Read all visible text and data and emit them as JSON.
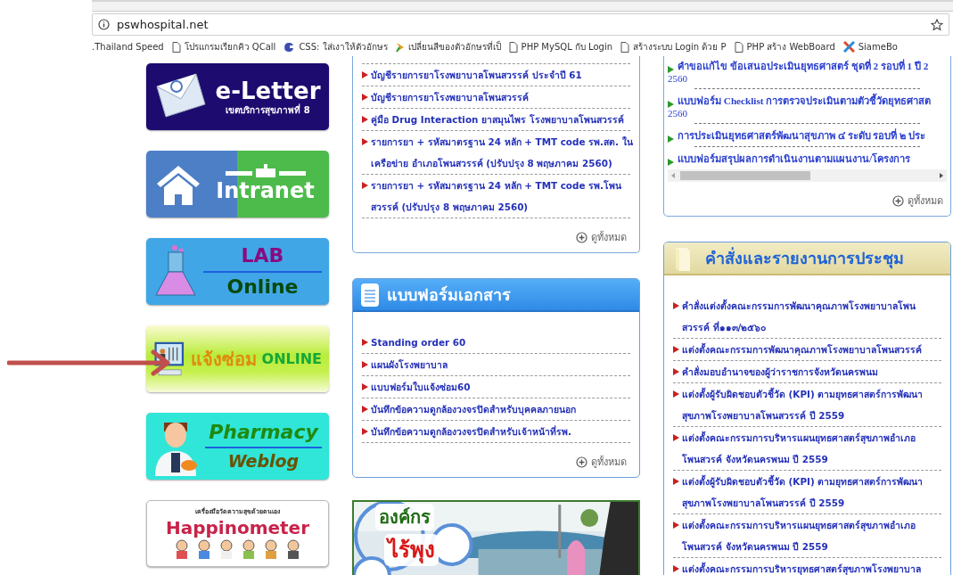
{
  "browser": {
    "url": "pswhospital.net",
    "bookmarks": [
      {
        "kind": "none",
        "label": ".Thailand Speed"
      },
      {
        "kind": "page",
        "label": "โปรแกรมเรียกคิว QCall"
      },
      {
        "kind": "circle",
        "label": "CSS: ใส่เงาให้ตัวอักษร"
      },
      {
        "kind": "arrow",
        "label": "เปลี่ยนสีของตัวอักษรที่เป็"
      },
      {
        "kind": "page",
        "label": "PHP MySQL กับ Login"
      },
      {
        "kind": "page",
        "label": "สร้างระบบ Login ด้วย P"
      },
      {
        "kind": "page",
        "label": "PHP สร้าง WebBoard"
      },
      {
        "kind": "cross",
        "label": "SiameBo"
      }
    ]
  },
  "banners": [
    {
      "kind": "eletter",
      "title": "e-Letter",
      "subtitle": "เขตบริการสุขภาพที่ 8"
    },
    {
      "kind": "intranet",
      "title": "Intranet"
    },
    {
      "kind": "lab",
      "title": "LAB",
      "subtitle": "Online"
    },
    {
      "kind": "repair",
      "title": "แจ้งซ่อม",
      "subtitle": "ONLINE"
    },
    {
      "kind": "pharmacy",
      "title": "Pharmacy",
      "subtitle": "Weblog"
    },
    {
      "kind": "happinometer",
      "title": "Happinometer",
      "subtitle": "เครื่องมือวัดความสุขด้วยตนเอง"
    }
  ],
  "drug_panel": {
    "items": [
      {
        "lines": [
          "บัญชีรายการยาโรงพยาบาลโพนสวรรค์ ประจำปี 61"
        ]
      },
      {
        "lines": [
          "บัญชีรายการยาโรงพยาบาลโพนสวรรค์"
        ]
      },
      {
        "lines": [
          "คู่มือ Drug Interaction ยาสมุนไพร โรงพยาบาลโพนสวรรค์"
        ]
      },
      {
        "lines": [
          "รายการยา + รหัสมาตรฐาน 24 หลัก + TMT code รพ.สต. ใน",
          "เครือข่าย อำเภอโพนสวรรค์ (ปรับปรุง 8 พฤษภาคม 2560)"
        ]
      },
      {
        "lines": [
          "รายการยา + รหัสมาตรฐาน 24 หลัก + TMT code รพ.โพน",
          "สวรรค์ (ปรับปรุง 8 พฤษภาคม 2560)"
        ]
      }
    ],
    "more": "ดูทั้งหมด"
  },
  "forms_panel": {
    "title": "แบบฟอร์มเอกสาร",
    "items": [
      {
        "lines": [
          "Standing order 60"
        ]
      },
      {
        "lines": [
          "แผนผังโรงพยาบาล"
        ]
      },
      {
        "lines": [
          "แบบฟอร์มใบแจ้งซ่อม60"
        ]
      },
      {
        "lines": [
          "บันทึกข้อความดูกล้องวงจรปิดสำหรับบุคคลภายนอก"
        ]
      },
      {
        "lines": [
          "บันทึกข้อความดูกล้องวงจรปิดสำหรับเจ้าหน้าที่รพ."
        ]
      }
    ],
    "more": "ดูทั้งหมด"
  },
  "promo": {
    "kind": "picture",
    "line_1": "องค์กร",
    "line_2": "ไร้พุง"
  },
  "strategy_panel": {
    "items": [
      {
        "text": "คำขอแก้ไข ข้อเสนอประเมินยุทธศาสตร์ ชุดที่ 2 รอบที่ 1 ปี 2",
        "continuation": "2560"
      },
      {
        "text": "แบบฟอร์ม Checklist การตรวจประเมินตามตัวชี้วัดยุทธศาสต",
        "continuation": "2560"
      },
      {
        "text": "การประเมินยุทธศาสตร์พัฒนาสุขภาพ ๔ ระดับ รอบที่ ๒ ประ"
      },
      {
        "text": "แบบฟอร์มสรุปผลการดำเนินงานตามแผนงาน/โครงการ"
      }
    ],
    "more": "ดูทั้งหมด"
  },
  "meetings_panel": {
    "title": "คำสั่งและรายงานการประชุม",
    "items": [
      {
        "lines": [
          "คำสั่งแต่งตั้งคณะกรรมการพัฒนาคุณภาพโรงพยาบาลโพน",
          "สวรรค์ ที่๑๑๓/๒๕๖๐"
        ]
      },
      {
        "lines": [
          "แต่งตั้งคณะกรรมการพัฒนาคุณภาพโรงพยาบาลโพนสวรรค์"
        ]
      },
      {
        "lines": [
          "คำสั่งมอบอำนาจของผู้ว่าราชการจังหวัดนครพนม"
        ]
      },
      {
        "lines": [
          "แต่งตั้งผู้รับผิดชอบตัวชี้วัด (KPI) ตามยุทธศาสตร์การพัฒนา",
          "สุขภาพโรงพยาบาลโพนสวรรค์ ปี 2559"
        ]
      },
      {
        "lines": [
          "แต่งตั้งคณะกรรมการบริหารแผนยุทธศาสตร์สุขภาพอำเภอ",
          "โพนสวรค์ จังหวัดนครพนม ปี 2559"
        ]
      },
      {
        "lines": [
          "แต่งตั้งผู้รับผิดชอบตัวชี้วัด (KPI) ตามยุทธศาสตร์การพัฒนา",
          "สุขภาพโรงพยาบาลโพนสวรรค์ ปี 2559"
        ]
      },
      {
        "lines": [
          "แต่งตั้งคณะกรรมการบริหารแผนยุทธศาสตร์สุขภาพอำเภอ",
          "โพนสวรค์ จังหวัดนครพนม ปี 2559"
        ]
      },
      {
        "lines": [
          "แต่งตั้งคณะกรรมการบริหารยุทธศาสตร์สุขภาพโรงพยาบาล"
        ]
      }
    ]
  }
}
